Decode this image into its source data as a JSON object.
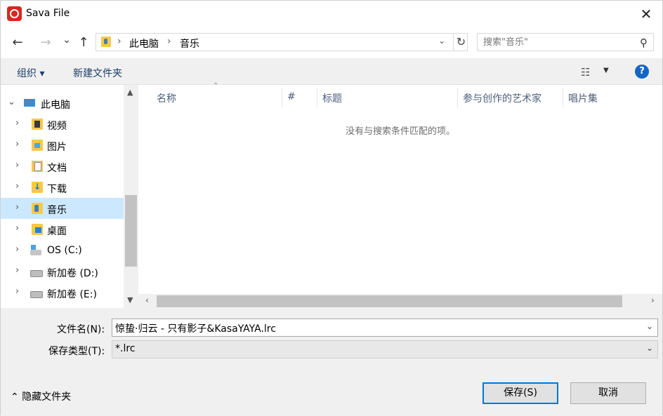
{
  "window": {
    "title": "Sava File",
    "close_glyph": "✕"
  },
  "nav": {
    "back_glyph": "←",
    "forward_glyph": "→",
    "recent_glyph": "⌄",
    "up_glyph": "↑",
    "breadcrumbs": [
      "此电脑",
      "音乐"
    ],
    "refresh_glyph": "↻",
    "search_placeholder": "搜索\"音乐\""
  },
  "toolbar": {
    "organize": "组织 ▾",
    "new_folder": "新建文件夹",
    "help": "?"
  },
  "tree": [
    {
      "label": "此电脑",
      "icon": "pc-icon",
      "expanded": true
    },
    {
      "label": "视频",
      "icon": "video-folder-icon"
    },
    {
      "label": "图片",
      "icon": "pictures-folder-icon"
    },
    {
      "label": "文档",
      "icon": "documents-folder-icon"
    },
    {
      "label": "下载",
      "icon": "downloads-folder-icon"
    },
    {
      "label": "音乐",
      "icon": "music-folder-icon",
      "selected": true
    },
    {
      "label": "桌面",
      "icon": "desktop-folder-icon"
    },
    {
      "label": "OS (C:)",
      "icon": "os-drive-icon"
    },
    {
      "label": "新加卷 (D:)",
      "icon": "drive-icon"
    },
    {
      "label": "新加卷 (E:)",
      "icon": "drive-icon"
    }
  ],
  "columns": [
    "名称",
    "#",
    "标题",
    "参与创作的艺术家",
    "唱片集"
  ],
  "empty_message": "没有与搜索条件匹配的项。",
  "form": {
    "filename_label": "文件名(N):",
    "filename_value": "惊蛰·归云 - 只有影子&KasaYAYA.lrc",
    "type_label": "保存类型(T):",
    "type_value": "*.lrc"
  },
  "footer": {
    "hide_folders": "隐藏文件夹",
    "save": "保存(S)",
    "cancel": "取消"
  },
  "colors": {
    "selection": "#cce8ff",
    "accent": "#0078d7",
    "help": "#1366c5",
    "app_icon": "#d7271f"
  }
}
